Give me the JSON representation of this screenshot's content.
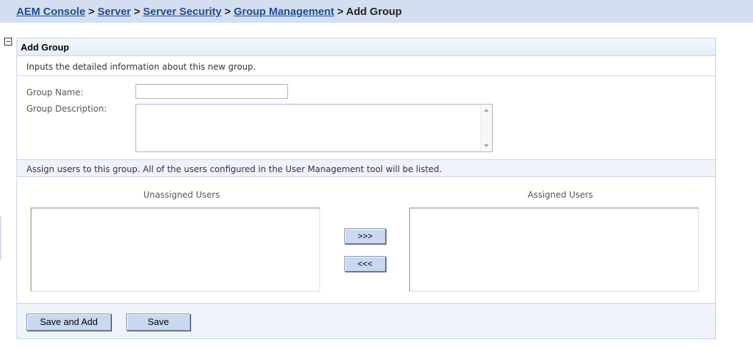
{
  "breadcrumb": {
    "items": [
      "AEM Console",
      "Server",
      "Server Security",
      "Group Management"
    ],
    "separator": ">",
    "current": "Add Group"
  },
  "panel": {
    "title": "Add Group",
    "description": "Inputs the detailed information about this new group."
  },
  "form": {
    "group_name_label": "Group Name:",
    "group_name_value": "",
    "group_description_label": "Group Description:",
    "group_description_value": ""
  },
  "assign": {
    "instructions": "Assign users to this group. All of the users configured in the User Management tool will be listed.",
    "unassigned_heading": "Unassigned Users",
    "assigned_heading": "Assigned Users",
    "unassigned_users": [],
    "assigned_users": [],
    "add_button_label": ">>>",
    "remove_button_label": "<<<"
  },
  "actions": {
    "save_and_add_label": "Save and Add",
    "save_label": "Save"
  },
  "icons": {
    "collapse": "collapse-minus-icon",
    "scroll_up": "scroll-up-arrow-icon",
    "scroll_down": "scroll-down-arrow-icon"
  },
  "colors": {
    "breadcrumb_bar": "#d3dff0",
    "link": "#1d4a93",
    "panel_border": "#c5d4e8",
    "section_background": "#eef3fa",
    "button_background": "#c7d8f0"
  }
}
